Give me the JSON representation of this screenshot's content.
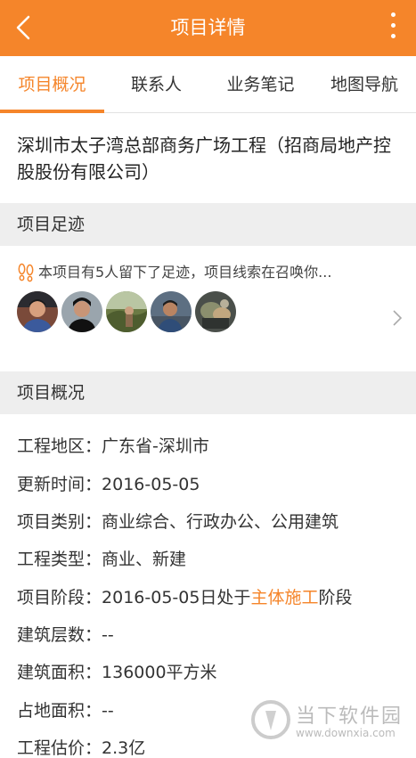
{
  "appbar": {
    "title": "项目详情",
    "back_icon": "back-arrow-icon",
    "menu_icon": "more-vertical-icon"
  },
  "tabs": [
    {
      "label": "项目概况",
      "active": true
    },
    {
      "label": "联系人",
      "active": false
    },
    {
      "label": "业务笔记",
      "active": false
    },
    {
      "label": "地图导航",
      "active": false
    }
  ],
  "project": {
    "title": "深圳市太子湾总部商务广场工程（招商局地产控股股份有限公司）"
  },
  "footprints": {
    "header": "项目足迹",
    "icon": "footprint-icon",
    "text": "本项目有5人留下了足迹，项目线索在召唤你...",
    "avatar_count": 5
  },
  "overview": {
    "header": "项目概况",
    "rows": [
      {
        "label": "工程地区：",
        "value": "广东省-深圳市"
      },
      {
        "label": "更新时间：",
        "value": "2016-05-05"
      },
      {
        "label": "项目类别：",
        "value": "商业综合、行政办公、公用建筑"
      },
      {
        "label": "工程类型：",
        "value": "商业、新建"
      },
      {
        "label": "项目阶段：",
        "value_prefix": "2016-05-05日处于",
        "value_highlight": "主体施工",
        "value_suffix": "阶段"
      },
      {
        "label": "建筑层数：",
        "value": "--"
      },
      {
        "label": "建筑面积：",
        "value": "136000平方米"
      },
      {
        "label": "占地面积：",
        "value": "--"
      },
      {
        "label": "工程估价：",
        "value": "2.3亿"
      }
    ]
  },
  "watermark": {
    "text": "当下软件园",
    "url": "www.downxia.com"
  },
  "colors": {
    "accent": "#f5852a"
  }
}
